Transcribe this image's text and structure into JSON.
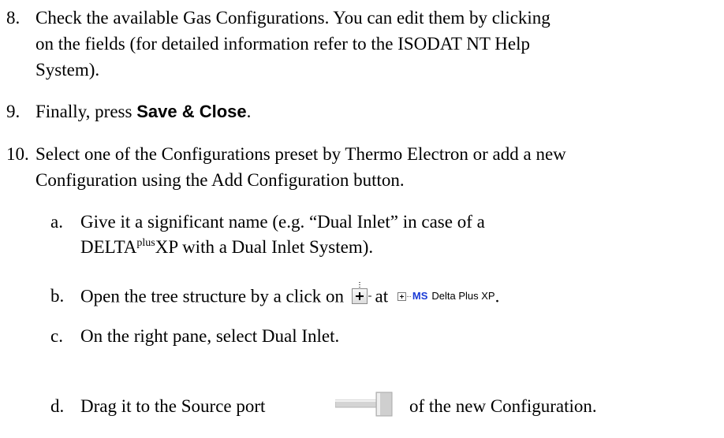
{
  "items": {
    "i8": {
      "number": "8.",
      "line1": "Check the available Gas Configurations. You can edit them by clicking",
      "line2": "on the fields (for detailed information refer to the ISODAT NT Help",
      "line3": "System)."
    },
    "i9": {
      "number": "9.",
      "text_before": "Finally, press ",
      "bold": "Save & Close",
      "text_after": "."
    },
    "i10": {
      "number": "10.",
      "line1": "Select one of the Configurations preset by Thermo Electron or add a new",
      "line2": "Configuration using the Add Configuration button."
    },
    "a": {
      "letter": "a.",
      "line1": "Give it a significant name (e.g. “Dual Inlet” in case of a",
      "line2_pre": "DELTA",
      "line2_sup": "plus",
      "line2_post": "XP with a Dual Inlet System)."
    },
    "b": {
      "letter": "b.",
      "text_before": "Open the tree structure by a click on",
      "text_mid": "at",
      "tree_ms": "MS",
      "tree_name": "Delta Plus XP",
      "text_after": "."
    },
    "c": {
      "letter": "c.",
      "text": "On the right pane, select Dual Inlet."
    },
    "d": {
      "letter": "d.",
      "text_before": "Drag it to the Source port",
      "text_after": "of the new Configuration."
    }
  },
  "icons": {
    "expand": "expand-plus-icon",
    "tree": "ms-tree-node-icon",
    "port": "source-port-icon"
  }
}
